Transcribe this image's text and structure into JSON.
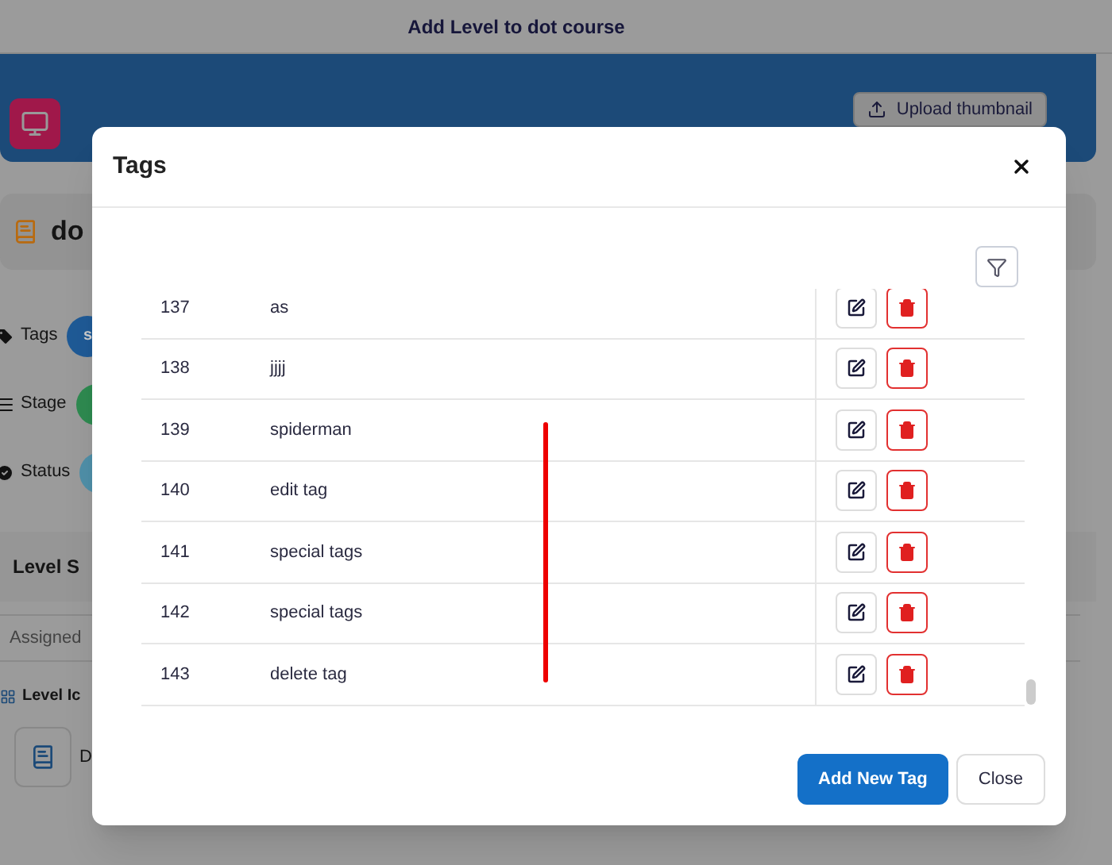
{
  "page": {
    "title": "Add Level to dot course",
    "upload_button": "Upload thumbnail",
    "course_title": "do",
    "fields": [
      {
        "kind": "tags",
        "label": "Tags",
        "badge": "s",
        "color": "#1f5a96"
      },
      {
        "kind": "stage",
        "label": "Stage",
        "color": "#2e8a50"
      },
      {
        "kind": "status",
        "label": "Status",
        "color": "#4f8fa8"
      }
    ],
    "section_title": "Level S",
    "assigned_placeholder": "Assigned",
    "level_icon_label": "Level Ic",
    "icon_item": "D"
  },
  "dialog": {
    "title": "Tags",
    "rows": [
      {
        "number": "137",
        "name": "as"
      },
      {
        "number": "138",
        "name": "jjjj"
      },
      {
        "number": "139",
        "name": "spiderman"
      },
      {
        "number": "140",
        "name": "edit tag"
      },
      {
        "number": "141",
        "name": "special tags"
      },
      {
        "number": "142",
        "name": "special tags"
      },
      {
        "number": "143",
        "name": "delete tag"
      }
    ],
    "buttons": [
      {
        "kind": "primary",
        "label": "Add New Tag"
      },
      {
        "kind": "secondary",
        "label": "Close"
      }
    ]
  }
}
